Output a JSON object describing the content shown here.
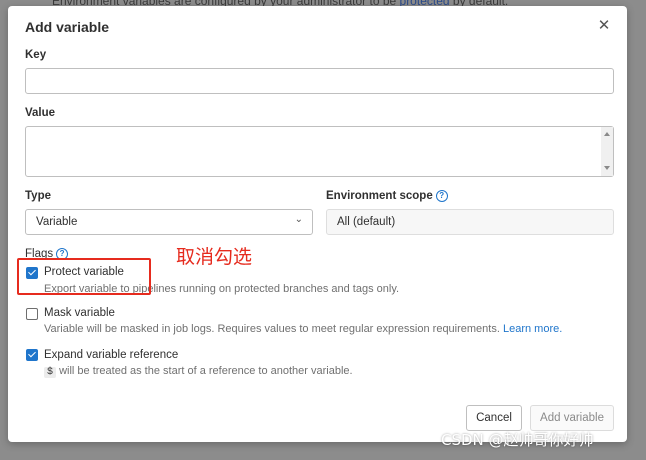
{
  "backdrop": {
    "text": "Environment variables are configured by your administrator to be ",
    "link": "protected",
    "text_after": " by default."
  },
  "modal": {
    "title": "Add variable",
    "close_icon": "close-icon",
    "key": {
      "label": "Key",
      "value": ""
    },
    "value": {
      "label": "Value",
      "value": ""
    },
    "type": {
      "label": "Type",
      "selected": "Variable"
    },
    "environment_scope": {
      "label": "Environment scope",
      "value": "All (default)"
    },
    "flags": {
      "label": "Flags",
      "protect": {
        "label": "Protect variable",
        "help": "Export variable to pipelines running on protected branches and tags only.",
        "checked": true
      },
      "mask": {
        "label": "Mask variable",
        "help": "Variable will be masked in job logs. Requires values to meet regular expression requirements.",
        "learn_more": "Learn more.",
        "checked": false
      },
      "expand": {
        "label": "Expand variable reference",
        "code": "$",
        "help": " will be treated as the start of a reference to another variable.",
        "checked": true
      }
    },
    "buttons": {
      "cancel": "Cancel",
      "add": "Add variable"
    }
  },
  "annotation": {
    "text": "取消勾选"
  },
  "watermark": "CSDN @赵帅哥你好帅",
  "colors": {
    "accent": "#1f75cb",
    "annotation": "#e62b1e"
  }
}
